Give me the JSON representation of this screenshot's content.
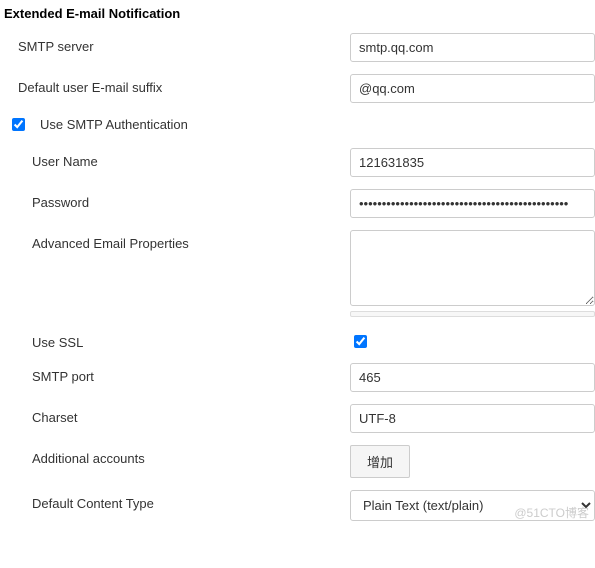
{
  "section": {
    "title": "Extended E-mail Notification"
  },
  "smtp_server": {
    "label": "SMTP server",
    "value": "smtp.qq.com"
  },
  "default_suffix": {
    "label": "Default user E-mail suffix",
    "value": "@qq.com"
  },
  "use_auth": {
    "label": "Use SMTP Authentication",
    "checked": true
  },
  "username": {
    "label": "User Name",
    "value": "121631835"
  },
  "password": {
    "label": "Password",
    "value": "••••••••••••••••••••••••••••••••••••••••••••••"
  },
  "advanced": {
    "label": "Advanced Email Properties",
    "value": ""
  },
  "use_ssl": {
    "label": "Use SSL",
    "checked": true
  },
  "smtp_port": {
    "label": "SMTP port",
    "value": "465"
  },
  "charset": {
    "label": "Charset",
    "value": "UTF-8"
  },
  "additional_accounts": {
    "label": "Additional accounts",
    "button": "增加"
  },
  "default_content_type": {
    "label": "Default Content Type",
    "selected": "Plain Text (text/plain)"
  },
  "watermark": "@51CTO博客"
}
